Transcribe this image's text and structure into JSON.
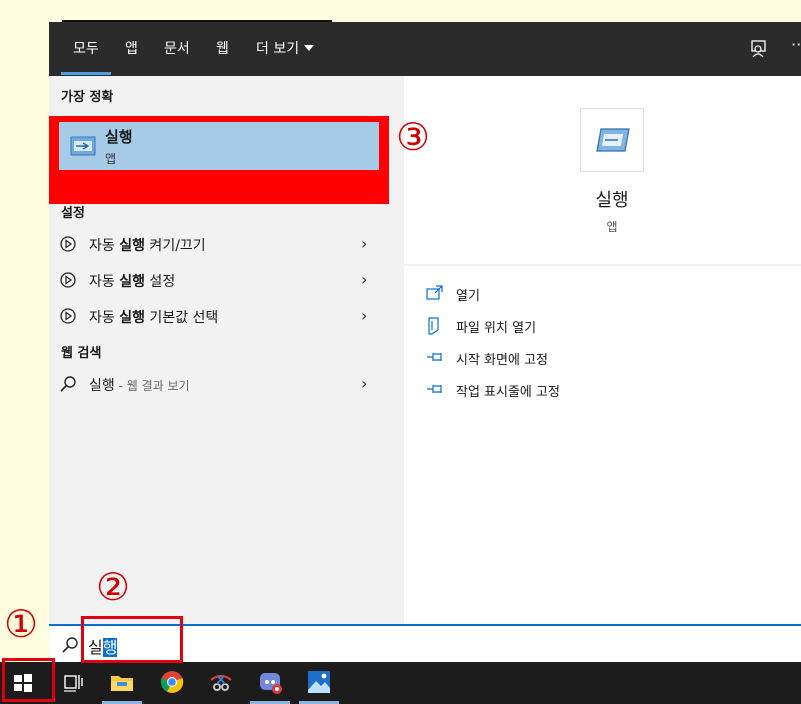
{
  "tabs": [
    {
      "label": "모두",
      "active": true
    },
    {
      "label": "앱"
    },
    {
      "label": "문서"
    },
    {
      "label": "웹"
    },
    {
      "label": "더 보기"
    }
  ],
  "more_label": "···",
  "sections": {
    "best_match": "가장 정확",
    "settings": "설정",
    "web": "웹 검색"
  },
  "best_match": {
    "title": "실행",
    "subtitle": "앱"
  },
  "settings_items": [
    {
      "prefix": "자동 ",
      "bold": "실행",
      "suffix": " 켜기/끄기"
    },
    {
      "prefix": "자동 ",
      "bold": "실행",
      "suffix": " 설정"
    },
    {
      "prefix": "자동 ",
      "bold": "실행",
      "suffix": " 기본값 선택"
    }
  ],
  "web_item": {
    "query": "실행",
    "suffix": " - 웹 결과 보기"
  },
  "chevron": "›",
  "preview": {
    "title": "실행",
    "subtitle": "앱"
  },
  "actions": [
    {
      "label": "열기",
      "icon": "open-icon"
    },
    {
      "label": "파일 위치 열기",
      "icon": "file-location-icon"
    },
    {
      "label": "시작 화면에 고정",
      "icon": "pin-icon"
    },
    {
      "label": "작업 표시줄에 고정",
      "icon": "pin-icon"
    }
  ],
  "search": {
    "typed": "실",
    "selected": "행"
  },
  "annotations": {
    "step1": "①",
    "step2": "②",
    "step3": "③"
  },
  "colors": {
    "accent": "#0a6fcf",
    "annotation_red": "#e1000f",
    "selection": "#a6cbe7"
  }
}
